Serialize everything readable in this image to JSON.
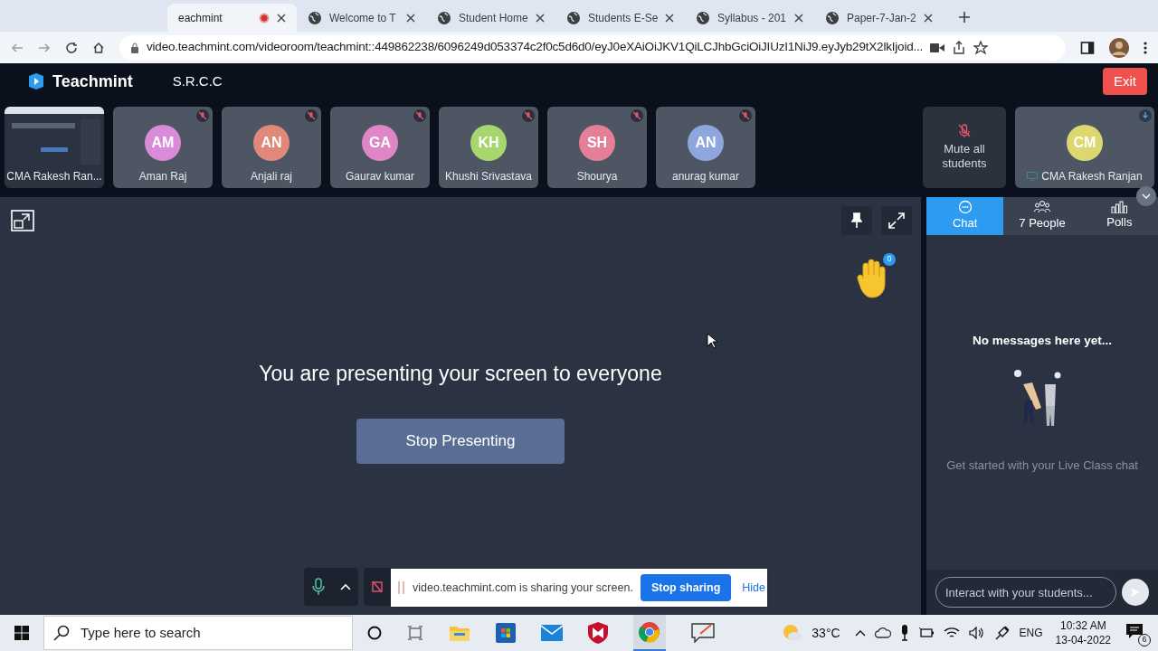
{
  "browser": {
    "tabs": [
      {
        "title": "eachmint",
        "selected": true,
        "recording": true
      },
      {
        "title": "Welcome to T",
        "selected": false,
        "recording": false
      },
      {
        "title": "Student Home",
        "selected": false,
        "recording": false
      },
      {
        "title": "Students E-Se",
        "selected": false,
        "recording": false
      },
      {
        "title": "Syllabus - 201",
        "selected": false,
        "recording": false
      },
      {
        "title": "Paper-7-Jan-2",
        "selected": false,
        "recording": false
      }
    ],
    "url": "video.teachmint.com/videoroom/teachmint::449862238/6096249d053374c2f0c5d6d0/eyJ0eXAiOiJKV1QiLCJhbGciOiJIUzI1NiJ9.eyJyb29tX2lkIjoid..."
  },
  "header": {
    "brand": "Teachmint",
    "class_name": "S.R.C.C",
    "exit": "Exit"
  },
  "participants": [
    {
      "kind": "screen",
      "name": "CMA Rakesh Ran...",
      "muted": false
    },
    {
      "kind": "avatar",
      "name": "Aman Raj",
      "initials": "AM",
      "color": "#d98ad8",
      "muted": true
    },
    {
      "kind": "avatar",
      "name": "Anjali raj",
      "initials": "AN",
      "color": "#e0897a",
      "muted": true
    },
    {
      "kind": "avatar",
      "name": "Gaurav kumar",
      "initials": "GA",
      "color": "#de86c6",
      "muted": true
    },
    {
      "kind": "avatar",
      "name": "Khushi Srivastava",
      "initials": "KH",
      "color": "#a7d66e",
      "muted": true
    },
    {
      "kind": "avatar",
      "name": "Shourya",
      "initials": "SH",
      "color": "#e47f98",
      "muted": true
    },
    {
      "kind": "avatar",
      "name": "anurag kumar",
      "initials": "AN",
      "color": "#8ea6de",
      "muted": true
    }
  ],
  "mute_all": "Mute all students",
  "teacher": {
    "name": "CMA Rakesh Ranjan",
    "initials": "CM",
    "color": "#dcd870"
  },
  "stage": {
    "message": "You are presenting your screen to everyone",
    "stop_button": "Stop Presenting",
    "hand_count": "0"
  },
  "chat_tabs": [
    {
      "label": "Chat",
      "selected": true
    },
    {
      "label": "7 People",
      "selected": false
    },
    {
      "label": "Polls",
      "selected": false
    }
  ],
  "chat": {
    "empty_title": "No messages here yet...",
    "empty_hint": "Get started with your Live Class chat",
    "placeholder": "Interact with your students..."
  },
  "share_bar": {
    "text": "video.teachmint.com is sharing your screen.",
    "stop": "Stop sharing",
    "hide": "Hide"
  },
  "taskbar": {
    "search_placeholder": "Type here to search",
    "temperature": "33°C",
    "language": "ENG",
    "time": "10:32 AM",
    "date": "13-04-2022",
    "notifications": "6"
  }
}
